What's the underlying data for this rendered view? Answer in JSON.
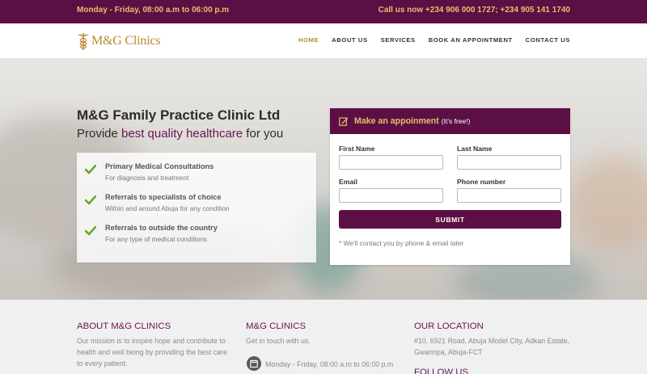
{
  "topbar": {
    "hours": "Monday - Friday, 08:00 a.m to 06:00 p.m",
    "phones": "Call us now +234 906 000 1727; +234 905 141 1740"
  },
  "brand": {
    "logo_text": "M&G Clinics",
    "logo_icon": "caduceus-icon"
  },
  "nav": {
    "items": [
      "HOME",
      "ABOUT US",
      "SERVICES",
      "BOOK AN APPOINTMENT",
      "CONTACT US"
    ],
    "active": "HOME"
  },
  "hero": {
    "title": "M&G Family Practice Clinic Ltd",
    "subtitle_before": "Provide ",
    "subtitle_highlight": "best quality healthcare",
    "subtitle_after": " for you",
    "features": [
      {
        "title": "Primary Medical Consultations",
        "desc": "For diagnosis and treatment"
      },
      {
        "title": "Referrals to specialists of choice",
        "desc": "Within and around Abuja for any condition"
      },
      {
        "title": "Referrals to outside the country",
        "desc": "For any type of medical conditions"
      }
    ]
  },
  "form": {
    "heading": "Make an appoinment",
    "heading_suffix": "(It's free!)",
    "first_name_label": "First Name",
    "last_name_label": "Last Name",
    "email_label": "Email",
    "phone_label": "Phone number",
    "first_name_value": "",
    "last_name_value": "",
    "email_value": "",
    "phone_value": "",
    "submit_label": "SUBMIT",
    "note": "* We'll contact you by phone & email later"
  },
  "footer": {
    "about_heading": "ABOUT M&G CLINICS",
    "about_line1": "Our mission is to inspire hope and contribute to",
    "about_line2": "health and well being by providing the best care",
    "about_line3": "to every patient.",
    "clinics_heading": "M&G CLINICS",
    "clinics_text": "Get in touch with us.",
    "clinics_hours": "Monday - Friday, 08:00 a.m to 06:00 p.m",
    "location_heading": "OUR LOCATION",
    "location_line1": "#10, 6921 Road, Abuja Model City, Adkan Estate,",
    "location_line2": "Gwarinpa, Abuja-FCT",
    "follow_heading": "FOLLOW US"
  },
  "colors": {
    "primary": "#5c0f44",
    "gold": "#e3c06a",
    "check": "#6aa52e"
  }
}
